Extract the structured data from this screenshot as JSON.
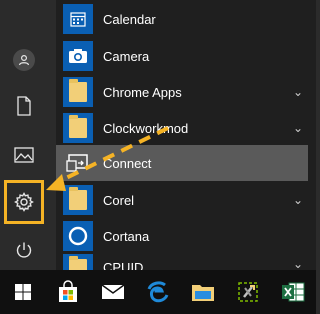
{
  "colors": {
    "rail_bg": "#2b2b2b",
    "list_bg": "#1f1f1f",
    "tile_blue": "#0a5fb3",
    "folder": "#f2cf78",
    "highlight": "#f5b325",
    "hover_row": "#5a5a5a",
    "taskbar_bg": "#101010"
  },
  "rail": {
    "items": [
      {
        "icon": "user-icon"
      },
      {
        "icon": "document-icon"
      },
      {
        "icon": "pictures-icon"
      },
      {
        "icon": "settings-gear-icon"
      },
      {
        "icon": "power-icon"
      }
    ]
  },
  "apps": [
    {
      "label": "Calendar",
      "icon": "calendar-icon",
      "expandable": false
    },
    {
      "label": "Camera",
      "icon": "camera-icon",
      "expandable": false
    },
    {
      "label": "Chrome Apps",
      "icon": "folder-icon",
      "expandable": true
    },
    {
      "label": "Clockworkmod",
      "icon": "folder-icon",
      "expandable": true
    },
    {
      "label": "Connect",
      "icon": "connect-icon",
      "expandable": false
    },
    {
      "label": "Corel",
      "icon": "folder-icon",
      "expandable": true
    },
    {
      "label": "Cortana",
      "icon": "cortana-icon",
      "expandable": false
    },
    {
      "label": "CPUID",
      "icon": "folder-icon",
      "expandable": true
    }
  ],
  "chevron": "⌄",
  "taskbar": {
    "items": [
      {
        "icon": "windows-start-icon"
      },
      {
        "icon": "store-icon"
      },
      {
        "icon": "mail-icon"
      },
      {
        "icon": "edge-icon"
      },
      {
        "icon": "file-explorer-icon"
      },
      {
        "icon": "tools-icon"
      },
      {
        "icon": "excel-icon"
      }
    ]
  }
}
